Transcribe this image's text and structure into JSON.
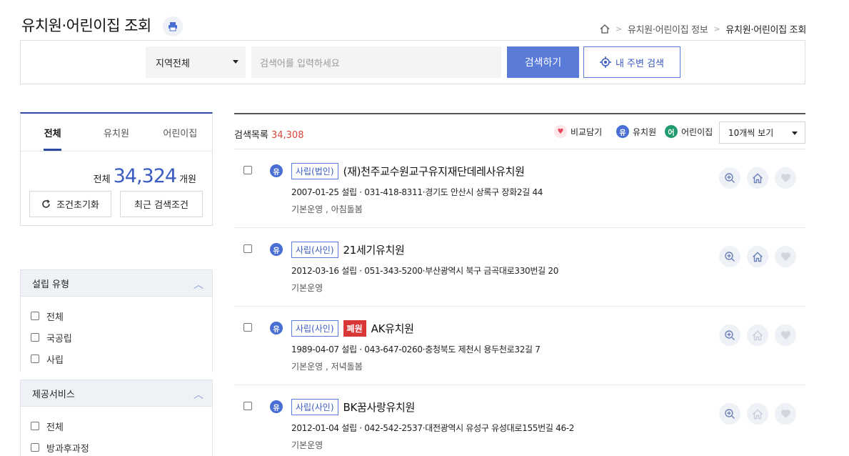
{
  "header": {
    "title": "유치원·어린이집 조회",
    "breadcrumb": [
      "유치원·어린이집 정보",
      "유치원·어린이집 조회"
    ]
  },
  "search": {
    "region": "지역전체",
    "placeholder": "검색어를 입력하세요",
    "search_label": "검색하기",
    "near_label": "내 주변 검색"
  },
  "left": {
    "tabs": [
      "전체",
      "유치원",
      "어린이집"
    ],
    "total_label": "전체",
    "total_count": "34,324",
    "total_unit": "개원",
    "reset_label": "조건초기화",
    "recent_label": "최근 검색조건"
  },
  "filters": [
    {
      "title": "설립 유형",
      "options": [
        "전체",
        "국공립",
        "사립"
      ]
    },
    {
      "title": "제공서비스",
      "options": [
        "전체",
        "방과후과정"
      ]
    }
  ],
  "list": {
    "count_label": "검색목록",
    "count": "34,308",
    "legend": {
      "compare": "비교담기",
      "kinder_abbr": "유",
      "kinder": "유치원",
      "daycare_abbr": "어",
      "daycare": "어린이집"
    },
    "per_page": "10개씩 보기",
    "items": [
      {
        "type": "유",
        "badge": "사립(법인)",
        "closed": "",
        "name": "(재)천주교수원교구유지재단데레사유치원",
        "meta": "2007-01-25 설립 · 031-418-8311·경기도 안산시 상록구 장화2길 44",
        "services": "기본운영 , 아침돌봄",
        "home_active": true
      },
      {
        "type": "유",
        "badge": "사립(사인)",
        "closed": "",
        "name": "21세기유치원",
        "meta": "2012-03-16 설립 · 051-343-5200·부산광역시 북구 금곡대로330번길 20",
        "services": "기본운영",
        "home_active": true
      },
      {
        "type": "유",
        "badge": "사립(사인)",
        "closed": "폐원",
        "name": "AK유치원",
        "meta": "1989-04-07 설립 · 043-647-0260·충청북도 제천시 용두천로32길 7",
        "services": "기본운영 , 저녁돌봄",
        "home_active": false
      },
      {
        "type": "유",
        "badge": "사립(사인)",
        "closed": "",
        "name": "BK꿈사랑유치원",
        "meta": "2012-01-04 설립 · 042-542-2537·대전광역시 유성구 유성대로155번길 46-2",
        "services": "기본운영",
        "home_active": false
      }
    ]
  },
  "colors": {
    "accent": "#5a7bd8",
    "navy": "#2c4aa0",
    "closed": "#d93636",
    "count": "#d9453b"
  }
}
